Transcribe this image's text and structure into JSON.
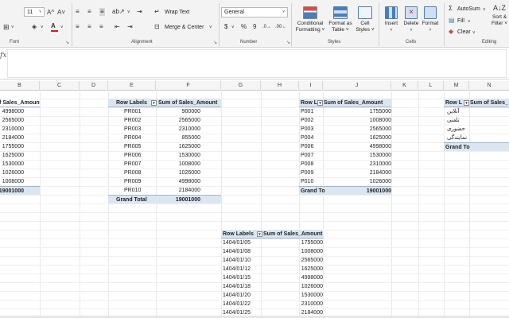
{
  "ribbon": {
    "font": {
      "size": "11",
      "grow_icon": "A^",
      "shrink_icon": "A˅",
      "label": "Font"
    },
    "alignment": {
      "wrap_text": "Wrap Text",
      "merge_center": "Merge & Center",
      "label": "Alignment"
    },
    "number": {
      "format": "General",
      "currency": "$",
      "percent": "%",
      "comma": "9",
      "label": "Number"
    },
    "styles": {
      "conditional_formatting": [
        "Conditional",
        "Formatting ˅"
      ],
      "format_as_table": [
        "Format as",
        "Table ˅"
      ],
      "cell_styles": [
        "Cell",
        "Styles ˅"
      ],
      "label": "Styles"
    },
    "cells": {
      "insert": "Insert",
      "delete": "Delete",
      "format": "Format",
      "label": "Cells"
    },
    "editing": {
      "autosum": "AutoSum",
      "fill": "Fill",
      "clear": "Clear",
      "sort_filter": [
        "Sort &",
        "Filter ˅"
      ],
      "label": "Editing"
    }
  },
  "formula_bar": {
    "fx": "fx",
    "value": ""
  },
  "columns": [
    "B",
    "C",
    "D",
    "E",
    "F",
    "G",
    "H",
    "I",
    "J",
    "K",
    "L",
    "M",
    "N"
  ],
  "pivot1": {
    "header_value": "Sum of Sales_Amount",
    "values": [
      "4998000",
      "2565000",
      "2310000",
      "2184000",
      "1755000",
      "1625000",
      "1530000",
      "1026000",
      "1008000"
    ],
    "total": "19001000"
  },
  "pivot2": {
    "header_label": "Row Labels",
    "header_value": "Sum of Sales_Amount",
    "rows": [
      {
        "label": "PR001",
        "value": "900000"
      },
      {
        "label": "PR002",
        "value": "2565000"
      },
      {
        "label": "PR003",
        "value": "2310000"
      },
      {
        "label": "PR004",
        "value": "855000"
      },
      {
        "label": "PR005",
        "value": "1625000"
      },
      {
        "label": "PR006",
        "value": "1530000"
      },
      {
        "label": "PR007",
        "value": "1008000"
      },
      {
        "label": "PR008",
        "value": "1026000"
      },
      {
        "label": "PR009",
        "value": "4998000"
      },
      {
        "label": "PR010",
        "value": "2184000"
      }
    ],
    "total_label": "Grand Total",
    "total_value": "19001000"
  },
  "pivot3": {
    "header_label": "Row L",
    "header_value": "Sum of Sales_Amount",
    "rows": [
      {
        "label": "P001",
        "value": "1755000"
      },
      {
        "label": "P002",
        "value": "1008000"
      },
      {
        "label": "P003",
        "value": "2565000"
      },
      {
        "label": "P004",
        "value": "1625000"
      },
      {
        "label": "P006",
        "value": "4998000"
      },
      {
        "label": "P007",
        "value": "1530000"
      },
      {
        "label": "P008",
        "value": "2310000"
      },
      {
        "label": "P009",
        "value": "2184000"
      },
      {
        "label": "P010",
        "value": "1026000"
      }
    ],
    "total_label": "Grand To",
    "total_value": "19001000"
  },
  "pivot4": {
    "header_label": "Row L",
    "header_value": "Sum of Sales_",
    "rows": [
      "آنلاین",
      "تلفنی",
      "حضوری",
      "نمایندگی"
    ],
    "total_label": "Grand To"
  },
  "pivot5": {
    "header_label": "Row Labels",
    "header_value": "Sum of Sales_Amount",
    "rows": [
      {
        "label": "1404/01/05",
        "value": "1755000"
      },
      {
        "label": "1404/01/08",
        "value": "1008000"
      },
      {
        "label": "1404/01/10",
        "value": "2565000"
      },
      {
        "label": "1404/01/12",
        "value": "1625000"
      },
      {
        "label": "1404/01/15",
        "value": "4998000"
      },
      {
        "label": "1404/01/18",
        "value": "1026000"
      },
      {
        "label": "1404/01/20",
        "value": "1530000"
      },
      {
        "label": "1404/01/22",
        "value": "2310000"
      },
      {
        "label": "1404/01/25",
        "value": "2184000"
      }
    ]
  },
  "colors": {
    "pivot_header": "#dce6f1",
    "pivot_border": "#9bb7d6",
    "ribbon_bg": "#f3f3f3"
  }
}
